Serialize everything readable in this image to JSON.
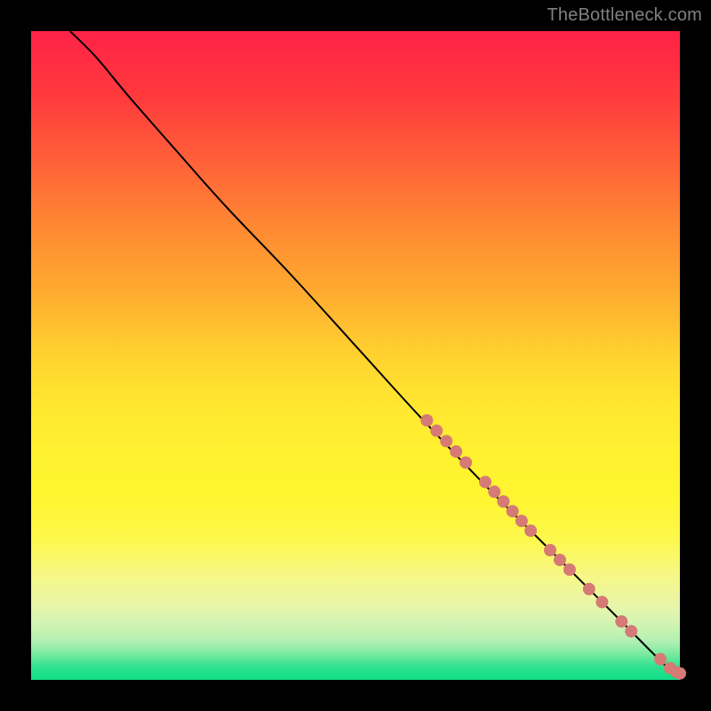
{
  "watermark": "TheBottleneck.com",
  "colors": {
    "dot": "#d67a75",
    "curve": "#000000"
  },
  "chart_data": {
    "type": "line",
    "title": "",
    "xlabel": "",
    "ylabel": "",
    "xlim": [
      0,
      100
    ],
    "ylim": [
      0,
      100
    ],
    "grid": false,
    "legend": false,
    "series": [
      {
        "name": "curve",
        "type": "line",
        "points": [
          {
            "x": 6,
            "y": 100
          },
          {
            "x": 10,
            "y": 96
          },
          {
            "x": 15,
            "y": 90
          },
          {
            "x": 22,
            "y": 82
          },
          {
            "x": 30,
            "y": 73
          },
          {
            "x": 40,
            "y": 62.5
          },
          {
            "x": 50,
            "y": 51.5
          },
          {
            "x": 60,
            "y": 40.5
          },
          {
            "x": 70,
            "y": 30
          },
          {
            "x": 80,
            "y": 20
          },
          {
            "x": 90,
            "y": 10
          },
          {
            "x": 98.5,
            "y": 1.5
          },
          {
            "x": 100,
            "y": 0.8
          }
        ]
      },
      {
        "name": "dots",
        "type": "scatter",
        "radius": 7,
        "points": [
          {
            "x": 61,
            "y": 40
          },
          {
            "x": 62.5,
            "y": 38.4
          },
          {
            "x": 64,
            "y": 36.8
          },
          {
            "x": 65.5,
            "y": 35.2
          },
          {
            "x": 67,
            "y": 33.5
          },
          {
            "x": 70,
            "y": 30.5
          },
          {
            "x": 71.4,
            "y": 29
          },
          {
            "x": 72.8,
            "y": 27.5
          },
          {
            "x": 74.2,
            "y": 26
          },
          {
            "x": 75.6,
            "y": 24.5
          },
          {
            "x": 77,
            "y": 23
          },
          {
            "x": 80,
            "y": 20
          },
          {
            "x": 81.5,
            "y": 18.5
          },
          {
            "x": 83,
            "y": 17
          },
          {
            "x": 86,
            "y": 14
          },
          {
            "x": 88,
            "y": 12
          },
          {
            "x": 91,
            "y": 9
          },
          {
            "x": 92.5,
            "y": 7.5
          },
          {
            "x": 97,
            "y": 3.2
          },
          {
            "x": 98.5,
            "y": 1.8
          },
          {
            "x": 99.5,
            "y": 1.2
          },
          {
            "x": 100,
            "y": 1.0
          }
        ]
      }
    ]
  }
}
